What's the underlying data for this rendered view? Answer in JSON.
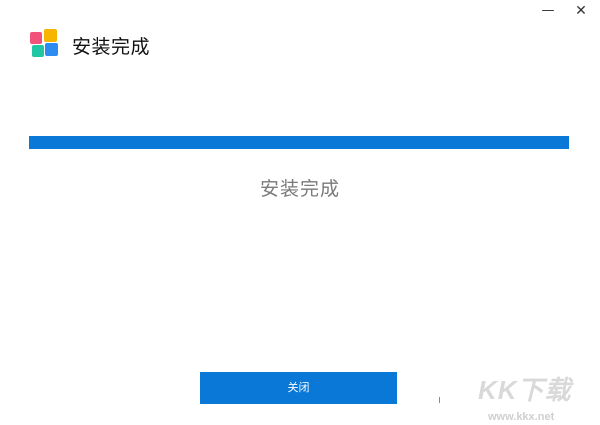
{
  "window": {
    "minimize_glyph": "—",
    "close_glyph": "✕"
  },
  "header": {
    "title": "安装完成",
    "logo_icon": "four-color-tiles-icon",
    "logo_colors": [
      "#f2517a",
      "#f7b500",
      "#1ec6a3",
      "#2d8cf0"
    ]
  },
  "progress": {
    "percent": 100,
    "color": "#0a78d6"
  },
  "status": {
    "text": "安装完成"
  },
  "footer": {
    "close_label": "关闭"
  },
  "watermark": {
    "logo_text": "KK下载",
    "url": "www.kkx.net"
  }
}
